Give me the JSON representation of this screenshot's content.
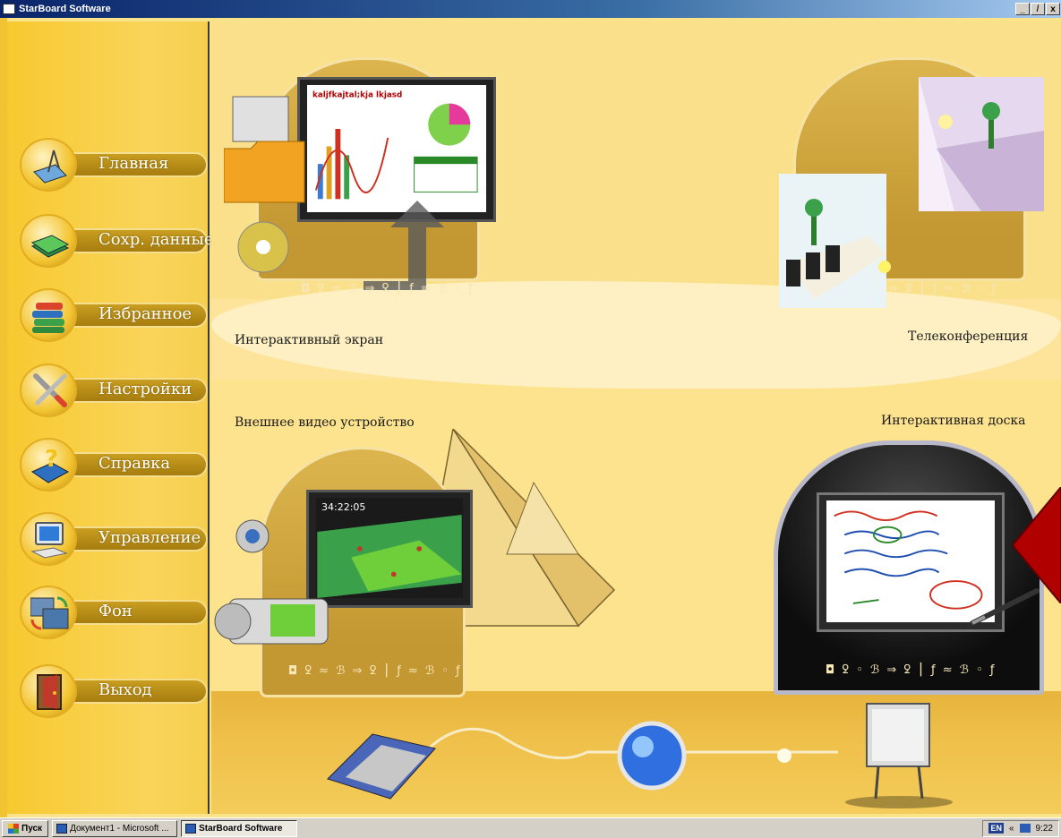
{
  "window": {
    "title": "StarBoard Software",
    "controls": {
      "minimize": "_",
      "restore": "̸",
      "close": "x"
    }
  },
  "sidebar": {
    "items": [
      {
        "label": "Главная",
        "icon": "home-icon"
      },
      {
        "label": "Сохр. данные",
        "icon": "saved-data-icon"
      },
      {
        "label": "Избранное",
        "icon": "favorites-books-icon"
      },
      {
        "label": "Настройки",
        "icon": "settings-tools-icon"
      },
      {
        "label": "Справка",
        "icon": "help-book-icon"
      },
      {
        "label": "Управление",
        "icon": "monitor-icon"
      },
      {
        "label": "Фон",
        "icon": "background-icon"
      },
      {
        "label": "Выход",
        "icon": "exit-door-icon"
      }
    ]
  },
  "tiles": {
    "interactive_screen": {
      "label": "Интерактивный экран",
      "screen_text": "kaljfkajtal;kja lkjasd",
      "hiero": "◘ ꝿ ≈ ℬ ⇒ ꝿ ⎮ ƒ ≈ ℬ ◦ ƒ"
    },
    "teleconference": {
      "label": "Телеконференция",
      "hiero": "⇒ ꝿ ⎮ ƒ ≈ ℬ ◦ ƒ"
    },
    "external_video": {
      "label": "Внешнее видео устройство",
      "video_time": "34:22:05",
      "hiero": "◘ ꝿ ≈ ℬ ⇒ ꝿ ⎮ ƒ ≈ ℬ ◦ ƒ"
    },
    "interactive_board": {
      "label": "Интерактивная доска",
      "hiero": "◘ ꝿ ◦ ℬ ⇒ ꝿ ⎮ ƒ ≈ ℬ ◦ ƒ"
    }
  },
  "taskbar": {
    "start_label": "Пуск",
    "tasks": [
      {
        "label": "Документ1 - Microsoft ...",
        "active": false
      },
      {
        "label": "StarBoard Software",
        "active": true
      }
    ],
    "tray": {
      "language": "EN",
      "chevron": "«",
      "time": "9:22"
    }
  },
  "colors": {
    "sidebar_bg": "#f9d459",
    "pill": "#b48a16",
    "content_bg": "#fde49a",
    "accent_red": "#b00000",
    "titlebar": "#0a246a"
  }
}
